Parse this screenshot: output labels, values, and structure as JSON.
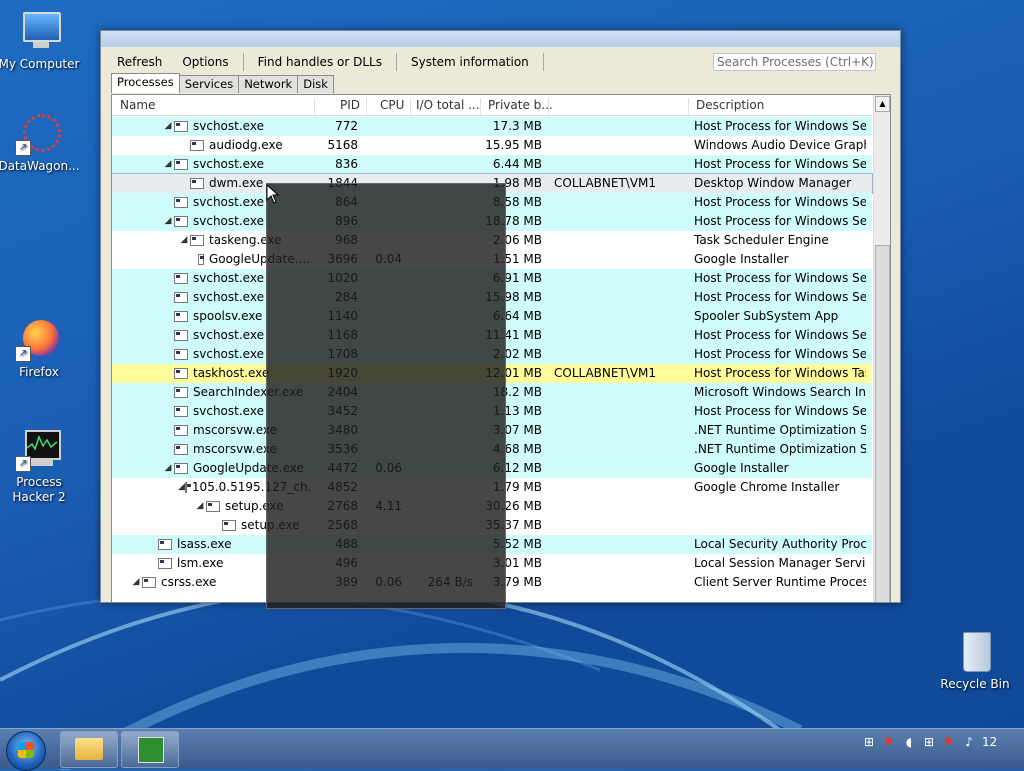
{
  "desktop": {
    "icons_left": [
      {
        "label": "My Computer",
        "icon": "computer-icon"
      },
      {
        "label": "DataWagon...",
        "icon": "datawagon-icon"
      },
      {
        "label": "Firefox",
        "icon": "firefox-icon"
      },
      {
        "label": "Process Hacker 2",
        "icon": "process-hacker-icon"
      }
    ],
    "recycle_bin": {
      "label": "Recycle Bin",
      "icon": "recycle-bin-icon"
    }
  },
  "window": {
    "toolbar": {
      "refresh": "Refresh",
      "options": "Options",
      "find_handles": "Find handles or DLLs",
      "system_information": "System information"
    },
    "search_placeholder": "Search Processes (Ctrl+K)",
    "tabs": [
      "Processes",
      "Services",
      "Network",
      "Disk"
    ],
    "active_tab": "Processes",
    "columns": {
      "name": "Name",
      "pid": "PID",
      "cpu": "CPU",
      "io": "I/O total ...",
      "private": "Private b...",
      "user": "",
      "description": "Description"
    },
    "processes": [
      {
        "indent": 3,
        "expander": "expanded",
        "name": "svchost.exe",
        "pid": "772",
        "cpu": "",
        "io": "",
        "private": "17.3 MB",
        "user": "",
        "desc": "Host Process for Windows Ser...",
        "style": "svc"
      },
      {
        "indent": 4,
        "expander": "",
        "name": "audiodg.exe",
        "pid": "5168",
        "cpu": "",
        "io": "",
        "private": "15.95 MB",
        "user": "",
        "desc": "Windows Audio Device Graph...",
        "style": "plain"
      },
      {
        "indent": 3,
        "expander": "expanded",
        "name": "svchost.exe",
        "pid": "836",
        "cpu": "",
        "io": "",
        "private": "6.44 MB",
        "user": "",
        "desc": "Host Process for Windows Ser...",
        "style": "svc"
      },
      {
        "indent": 4,
        "expander": "",
        "name": "dwm.exe",
        "pid": "1844",
        "cpu": "",
        "io": "",
        "private": "1.98 MB",
        "user": "COLLABNET\\VM1",
        "desc": "Desktop Window Manager",
        "style": "sel"
      },
      {
        "indent": 3,
        "expander": "",
        "name": "svchost.exe",
        "pid": "864",
        "cpu": "",
        "io": "",
        "private": "8.58 MB",
        "user": "",
        "desc": "Host Process for Windows Ser...",
        "style": "svc"
      },
      {
        "indent": 3,
        "expander": "expanded",
        "name": "svchost.exe",
        "pid": "896",
        "cpu": "",
        "io": "",
        "private": "18.78 MB",
        "user": "",
        "desc": "Host Process for Windows Ser...",
        "style": "svc"
      },
      {
        "indent": 4,
        "expander": "expanded",
        "name": "taskeng.exe",
        "pid": "968",
        "cpu": "",
        "io": "",
        "private": "2.06 MB",
        "user": "",
        "desc": "Task Scheduler Engine",
        "style": "plain"
      },
      {
        "indent": 5,
        "expander": "",
        "name": "GoogleUpdate....",
        "pid": "3696",
        "cpu": "0.04",
        "io": "",
        "private": "1.51 MB",
        "user": "",
        "desc": "Google Installer",
        "style": "plain"
      },
      {
        "indent": 3,
        "expander": "",
        "name": "svchost.exe",
        "pid": "1020",
        "cpu": "",
        "io": "",
        "private": "6.91 MB",
        "user": "",
        "desc": "Host Process for Windows Ser...",
        "style": "svc"
      },
      {
        "indent": 3,
        "expander": "",
        "name": "svchost.exe",
        "pid": "284",
        "cpu": "",
        "io": "",
        "private": "15.98 MB",
        "user": "",
        "desc": "Host Process for Windows Ser...",
        "style": "svc"
      },
      {
        "indent": 3,
        "expander": "",
        "name": "spoolsv.exe",
        "pid": "1140",
        "cpu": "",
        "io": "",
        "private": "6.64 MB",
        "user": "",
        "desc": "Spooler SubSystem App",
        "style": "svc"
      },
      {
        "indent": 3,
        "expander": "",
        "name": "svchost.exe",
        "pid": "1168",
        "cpu": "",
        "io": "",
        "private": "11.41 MB",
        "user": "",
        "desc": "Host Process for Windows Ser...",
        "style": "svc"
      },
      {
        "indent": 3,
        "expander": "",
        "name": "svchost.exe",
        "pid": "1708",
        "cpu": "",
        "io": "",
        "private": "2.02 MB",
        "user": "",
        "desc": "Host Process for Windows Ser...",
        "style": "svc"
      },
      {
        "indent": 3,
        "expander": "",
        "name": "taskhost.exe",
        "pid": "1920",
        "cpu": "",
        "io": "",
        "private": "12.01 MB",
        "user": "COLLABNET\\VM1",
        "desc": "Host Process for Windows Tas...",
        "style": "usr"
      },
      {
        "indent": 3,
        "expander": "",
        "name": "SearchIndexer.exe",
        "pid": "2404",
        "cpu": "",
        "io": "",
        "private": "18.2 MB",
        "user": "",
        "desc": "Microsoft Windows Search In...",
        "style": "svc"
      },
      {
        "indent": 3,
        "expander": "",
        "name": "svchost.exe",
        "pid": "3452",
        "cpu": "",
        "io": "",
        "private": "1.13 MB",
        "user": "",
        "desc": "Host Process for Windows Ser...",
        "style": "svc"
      },
      {
        "indent": 3,
        "expander": "",
        "name": "mscorsvw.exe",
        "pid": "3480",
        "cpu": "",
        "io": "",
        "private": "3.07 MB",
        "user": "",
        "desc": ".NET Runtime Optimization S...",
        "style": "svc"
      },
      {
        "indent": 3,
        "expander": "",
        "name": "mscorsvw.exe",
        "pid": "3536",
        "cpu": "",
        "io": "",
        "private": "4.68 MB",
        "user": "",
        "desc": ".NET Runtime Optimization S...",
        "style": "svc"
      },
      {
        "indent": 3,
        "expander": "expanded",
        "name": "GoogleUpdate.exe",
        "pid": "4472",
        "cpu": "0.06",
        "io": "",
        "private": "6.12 MB",
        "user": "",
        "desc": "Google Installer",
        "style": "svc"
      },
      {
        "indent": 4,
        "expander": "expanded",
        "name": "105.0.5195.127_ch...",
        "pid": "4852",
        "cpu": "",
        "io": "",
        "private": "1.79 MB",
        "user": "",
        "desc": "Google Chrome Installer",
        "style": "plain"
      },
      {
        "indent": 5,
        "expander": "expanded",
        "name": "setup.exe",
        "pid": "2768",
        "cpu": "4.11",
        "io": "",
        "private": "30.26 MB",
        "user": "",
        "desc": "",
        "style": "plain"
      },
      {
        "indent": 6,
        "expander": "",
        "name": "setup.exe",
        "pid": "2568",
        "cpu": "",
        "io": "",
        "private": "35.37 MB",
        "user": "",
        "desc": "",
        "style": "plain"
      },
      {
        "indent": 2,
        "expander": "",
        "name": "lsass.exe",
        "pid": "488",
        "cpu": "",
        "io": "",
        "private": "5.52 MB",
        "user": "",
        "desc": "Local Security Authority Proce...",
        "style": "svc"
      },
      {
        "indent": 2,
        "expander": "",
        "name": "lsm.exe",
        "pid": "496",
        "cpu": "",
        "io": "",
        "private": "3.01 MB",
        "user": "",
        "desc": "Local Session Manager Service",
        "style": "plain"
      },
      {
        "indent": 1,
        "expander": "expanded",
        "name": "csrss.exe",
        "pid": "389",
        "cpu": "0.06",
        "io": "264 B/s",
        "private": "3.79 MB",
        "user": "",
        "desc": "Client Server Runtime Process",
        "style": "plain"
      }
    ]
  },
  "taskbar": {
    "clock": "12"
  }
}
